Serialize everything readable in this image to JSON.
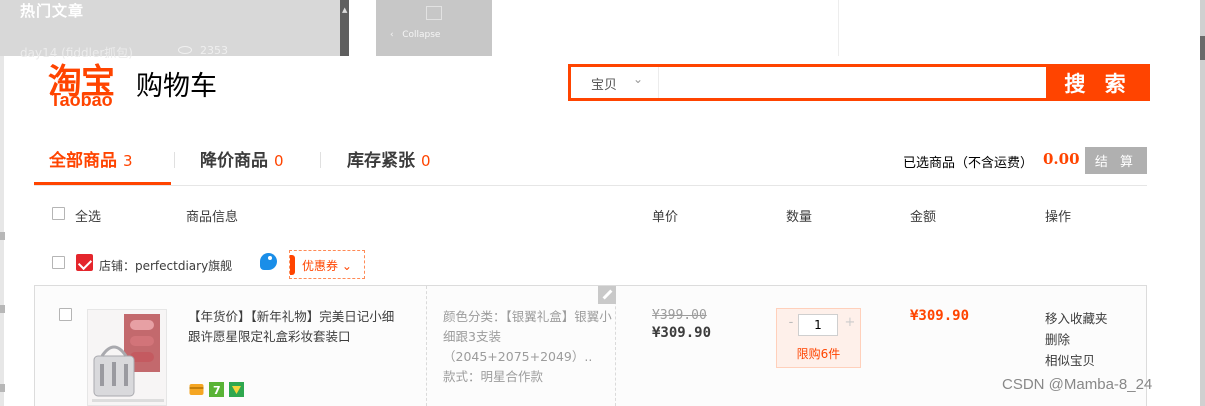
{
  "background_page": {
    "section_title": "热门文章",
    "post_title": "day14 (fiddler抓包)",
    "post_views": "2353",
    "collapse_label": "Collapse"
  },
  "header": {
    "logo_cn": "淘宝",
    "logo_en": "Taobao",
    "title": "购物车",
    "brand_color": "#ff4400"
  },
  "search": {
    "type_label": "宝贝",
    "type_chevron": "chevron-down-icon",
    "value": "",
    "button_label": "搜 索"
  },
  "tabs": [
    {
      "label": "全部商品",
      "count": "3",
      "active": true
    },
    {
      "label": "降价商品",
      "count": "0",
      "active": false
    },
    {
      "label": "库存紧张",
      "count": "0",
      "active": false
    }
  ],
  "summary": {
    "selected_label": "已选商品（不含运费）",
    "amount": "0.00",
    "checkout_label": "结 算"
  },
  "columns": {
    "select_all": "全选",
    "info": "商品信息",
    "unit_price": "单价",
    "quantity": "数量",
    "amount": "金额",
    "actions": "操作"
  },
  "shop": {
    "label": "店铺：perfectdiary旗舰",
    "coupon_label": "优惠券 ⌄"
  },
  "item": {
    "title": "【年货价】【新年礼物】完美日记小细跟许愿星限定礼盒彩妆套装口",
    "sku_line1": "颜色分类：【银翼礼盒】银翼小细跟3支装（2045+2075+2049）..",
    "sku_line2": "款式：明星合作款",
    "price_old": "¥399.00",
    "price_now": "¥309.90",
    "quantity": "1",
    "qty_minus": "-",
    "qty_plus": "+",
    "limit_label": "限购6件",
    "subtotal": "¥309.90",
    "actions": [
      "移入收藏夹",
      "删除",
      "相似宝贝"
    ]
  },
  "watermark": "CSDN @Mamba-8_24"
}
